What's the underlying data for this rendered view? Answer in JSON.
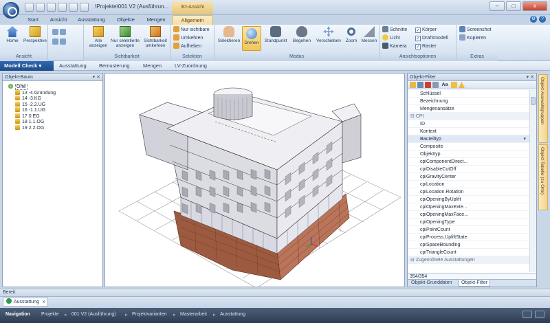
{
  "titlebar": {
    "title": "\\Projekte\\001 V2 (Ausführun...",
    "context_tab": "3D-Ansicht",
    "minimize": "–",
    "maximize": "□",
    "close": "x"
  },
  "tabs": [
    "Start",
    "Ansicht",
    "Ausstattung",
    "Objekte",
    "Mengen",
    "Allgemein"
  ],
  "active_tab": "Allgemein",
  "help": {
    "settings": "⚙",
    "help": "?"
  },
  "ribbon": {
    "groups": {
      "ansicht": "Ansicht",
      "sichtbarkeit": "Sichtbarkeit",
      "selektion": "Selektion",
      "modus": "Modus",
      "ansichtsoptionen": "Ansichtsoptionen",
      "extras": "Extras"
    },
    "buttons": {
      "home": "Home",
      "perspektive": "Perspektive",
      "alle_anzeigen": "Alle anzeigen",
      "nur_selektierte": "Nur selektierte anzeigen",
      "sichtbarkeit_umkehren": "Sichtbarkeit umkehren",
      "nur_sichtbare": "Nur sichtbare",
      "umkehren": "Umkehren",
      "aufheben": "Aufheben",
      "selektieren": "Selektieren",
      "drehen": "Drehen",
      "standpunkt": "Standpunkt",
      "begehen": "Begehen",
      "verschieben": "Verschieben",
      "zoom": "Zoom",
      "messen": "Messen",
      "schnitte": "Schnitte",
      "licht": "Licht",
      "kamera": "Kamera",
      "koerper": "Körper",
      "drahtmodell": "Drahtmodell",
      "raster": "Raster",
      "screenshot": "Screenshot",
      "kopieren": "Kopieren"
    },
    "checkboxes": {
      "koerper": true,
      "drahtmodell": true,
      "raster": true
    }
  },
  "breadcrumbs": [
    "Modell Check",
    "Ausstattung",
    "Bemusterung",
    "Mengen",
    "LV-Zuordnung"
  ],
  "left_panel": {
    "title": "Objekt-Baum",
    "controls": "▾ ✕",
    "tree": [
      {
        "label": "Orte",
        "level": 0
      },
      {
        "label": "13 -4.Gründung",
        "level": 1
      },
      {
        "label": "14 -3.KG",
        "level": 1
      },
      {
        "label": "15 -2.2.UG",
        "level": 1
      },
      {
        "label": "16 -1.1.UG",
        "level": 1
      },
      {
        "label": "17 0.EG",
        "level": 1
      },
      {
        "label": "18 1.1.OG",
        "level": 1
      },
      {
        "label": "19 2.2.OG",
        "level": 1
      }
    ]
  },
  "right_panel": {
    "title": "Objekt-Filter",
    "controls": "▾ ✕",
    "toolbar_text": "Aa",
    "rows": [
      {
        "label": "Schlüssel",
        "kind": "item"
      },
      {
        "label": "Bezeichnung",
        "kind": "item"
      },
      {
        "label": "Mengenansätze",
        "kind": "item"
      },
      {
        "label": "CPI",
        "kind": "category"
      },
      {
        "label": "ID",
        "kind": "item"
      },
      {
        "label": "Kontext",
        "kind": "item"
      },
      {
        "label": "Bauteiltyp",
        "kind": "selected"
      },
      {
        "label": "Composite",
        "kind": "item"
      },
      {
        "label": "Objekttyp",
        "kind": "item"
      },
      {
        "label": "cpiComponentDirect...",
        "kind": "item"
      },
      {
        "label": "cpiDisableCutOff",
        "kind": "item"
      },
      {
        "label": "cpiGravityCenter",
        "kind": "item"
      },
      {
        "label": "cpiLocation",
        "kind": "item"
      },
      {
        "label": "cpiLocation.Rotation",
        "kind": "item"
      },
      {
        "label": "cpiOpeningByUplift",
        "kind": "item"
      },
      {
        "label": "cpiOpeningMaxExte...",
        "kind": "item"
      },
      {
        "label": "cpiOpeningMaxFace...",
        "kind": "item"
      },
      {
        "label": "cpiOpeningType",
        "kind": "item"
      },
      {
        "label": "cpiPointCount",
        "kind": "item"
      },
      {
        "label": "cpiProcess.UpliftState",
        "kind": "item"
      },
      {
        "label": "cpiSpaceBounding",
        "kind": "item"
      },
      {
        "label": "cpiTriangleCount",
        "kind": "item"
      },
      {
        "label": "Zugeordnete Ausstattungen",
        "kind": "category"
      }
    ],
    "count": "354/354",
    "bottom_tabs": [
      "Objekt-Grunddaten",
      "Objekt-Filter"
    ],
    "active_bottom_tab": "Objekt-Filter"
  },
  "side_tabs": [
    "Objekt-Auswahlgruppen",
    "Objekt-Tabelle (zu Orte)"
  ],
  "status": {
    "text": "Bereit"
  },
  "doc_tab": {
    "label": "Ausstattung",
    "close": "x"
  },
  "navigation": {
    "label": "Navigation",
    "path": [
      "Projekte",
      "001 V2 (Ausführung)",
      "Projektvarianten",
      "Masterarbeit",
      "Ausstattung"
    ],
    "separator": "▸"
  },
  "colors": {
    "accent": "#2f68b1",
    "context_tab": "#f5dfa6",
    "building_wall": "#e4e4ea",
    "building_shadow": "#a9a9b3",
    "foundation": "#a05a3e",
    "grid_line": "#8a8a8a"
  }
}
